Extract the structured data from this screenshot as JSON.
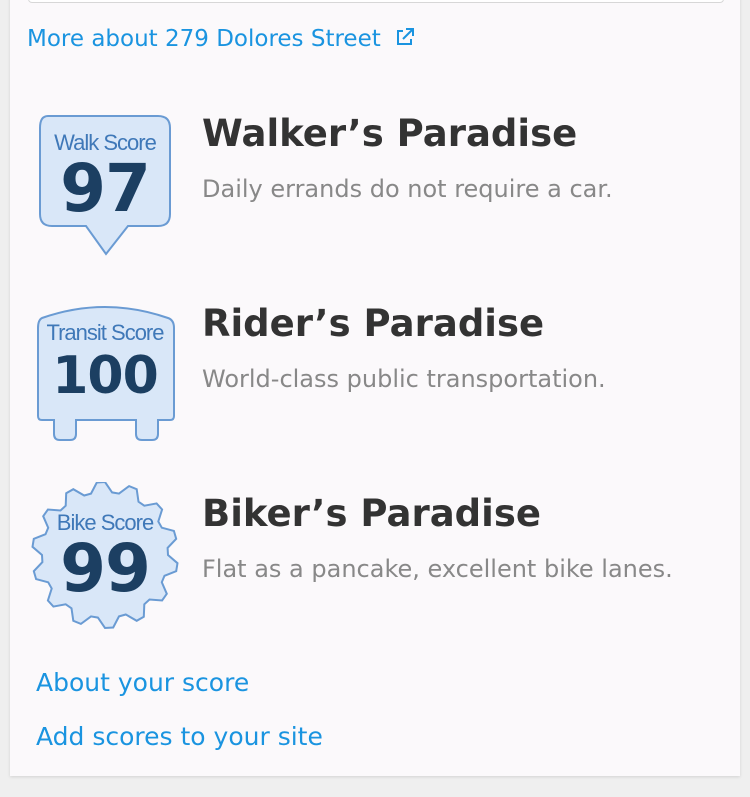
{
  "header": {
    "more_link": "More about 279 Dolores Street",
    "more_link_icon": "external-link-icon"
  },
  "scores": {
    "walk": {
      "badge_label": "Walk Score",
      "value": "97",
      "title": "Walker’s Paradise",
      "description": "Daily errands do not require a car.",
      "icon": "walk-score-badge-icon"
    },
    "transit": {
      "badge_label": "Transit Score",
      "value": "100",
      "title": "Rider’s Paradise",
      "description": "World-class public transportation.",
      "icon": "transit-score-badge-icon"
    },
    "bike": {
      "badge_label": "Bike Score",
      "value": "99",
      "title": "Biker’s Paradise",
      "description": "Flat as a pancake, excellent bike lanes.",
      "icon": "bike-score-badge-icon"
    }
  },
  "footer": {
    "about_link": "About your score",
    "add_link": "Add scores to your site"
  },
  "colors": {
    "link": "#1a94e0",
    "badge_fill": "#d9e7f8",
    "badge_stroke": "#6a9bd3",
    "badge_number": "#1c3f62",
    "badge_label": "#3f78b8",
    "title": "#333333",
    "description": "#888888"
  }
}
